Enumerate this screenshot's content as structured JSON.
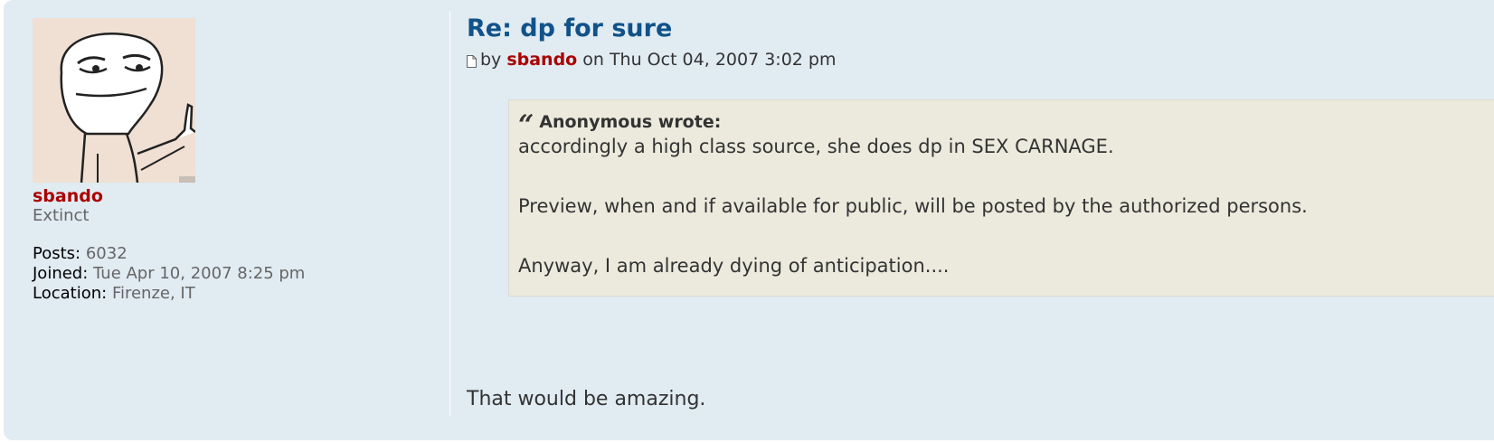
{
  "post": {
    "title": "Re: dp for sure",
    "meta": {
      "by_label": "by",
      "author": "sbando",
      "date": "on Thu Oct 04, 2007 3:02 pm",
      "icon": "post-icon"
    },
    "quote": {
      "icon": "quote-icon",
      "cite": "Anonymous wrote:",
      "lines": [
        "accordingly a high class source, she does dp in SEX CARNAGE.",
        "Preview, when and if available for public, will be posted by the authorized persons.",
        "Anyway, I am already dying of anticipation...."
      ]
    },
    "reply": "That would be amazing."
  },
  "profile": {
    "avatar": "avatar-image",
    "username": "sbando",
    "rank": "Extinct",
    "posts_label": "Posts:",
    "posts_value": "6032",
    "joined_label": "Joined:",
    "joined_value": "Tue Apr 10, 2007 8:25 pm",
    "location_label": "Location:",
    "location_value": "Firenze, IT"
  },
  "colors": {
    "post_bg": "#e1ebf2",
    "title": "#105289",
    "username": "#aa0000",
    "quote_bg": "#ebeadd"
  }
}
